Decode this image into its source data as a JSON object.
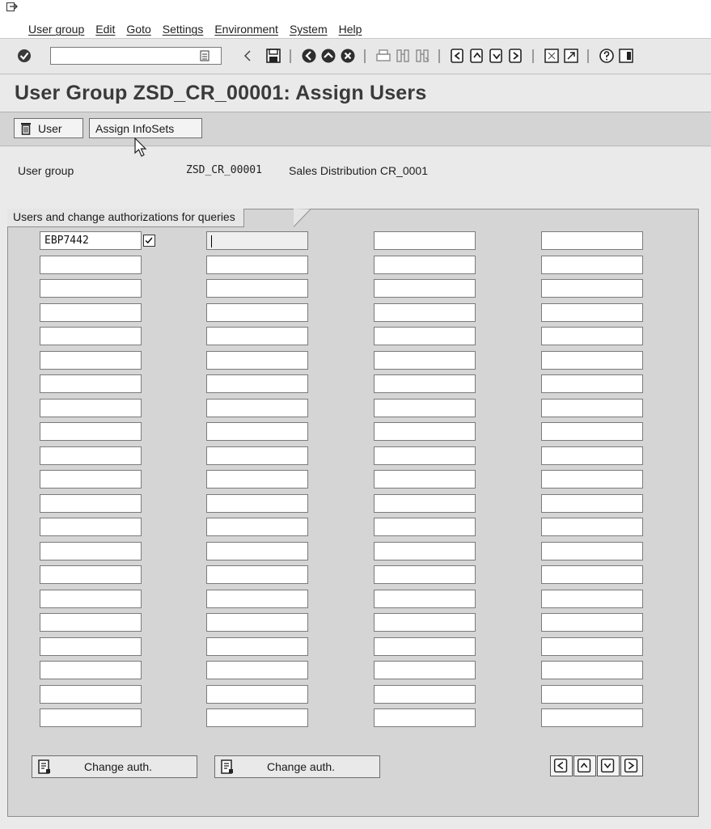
{
  "menu": {
    "items": [
      "User group",
      "Edit",
      "Goto",
      "Settings",
      "Environment",
      "System",
      "Help"
    ]
  },
  "toolbar": {
    "command_value": ""
  },
  "title": "User Group ZSD_CR_00001: Assign Users",
  "app_toolbar": {
    "user_button": "User",
    "assign_infosets_button": "Assign InfoSets"
  },
  "header": {
    "user_group_label": "User group",
    "user_group_id": "ZSD_CR_00001",
    "user_group_desc": "Sales Distribution CR_0001"
  },
  "users_box": {
    "title": "Users and change authorizations for queries",
    "first_user": "EBP7442",
    "first_user_change_auth": true,
    "rows_per_column": 21
  },
  "buttons": {
    "change_auth_1": "Change auth.",
    "change_auth_2": "Change auth."
  },
  "icons": [
    "system-menu-icon",
    "enter-icon",
    "command-history-icon",
    "back-arrow-icon",
    "save-icon",
    "back-icon",
    "exit-icon",
    "cancel-icon",
    "print-icon",
    "find-icon",
    "find-next-icon",
    "first-page-icon",
    "previous-page-icon",
    "next-page-icon",
    "last-page-icon",
    "create-session-icon",
    "shortcut-icon",
    "help-icon",
    "layout-menu-icon",
    "trash-icon",
    "change-auth-icon"
  ]
}
